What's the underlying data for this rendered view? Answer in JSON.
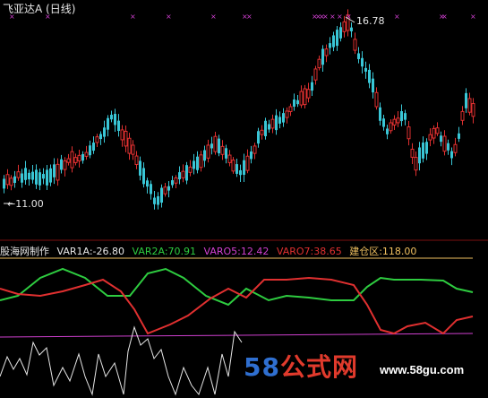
{
  "header": {
    "title": "飞亚达A (日线)"
  },
  "price_labels": {
    "high": "16.78",
    "low": "11.00"
  },
  "indicator": {
    "name": "股海网制作",
    "items": [
      {
        "text": "VAR1A:-26.80",
        "color": "#e6e6e6"
      },
      {
        "text": "VAR2A:70.91",
        "color": "#2ecc40"
      },
      {
        "text": "VARO5:12.42",
        "color": "#d040d0"
      },
      {
        "text": "VARO7:38.65",
        "color": "#e03030"
      },
      {
        "text": "建仓区:118.00",
        "color": "#f0c060"
      }
    ]
  },
  "watermark": {
    "number": "58",
    "text": "公式网",
    "site": "www.58gu.com"
  },
  "colors": {
    "up": "#e03030",
    "down": "#39c6d6",
    "marker": "#d040d0",
    "bg": "#000000"
  }
}
